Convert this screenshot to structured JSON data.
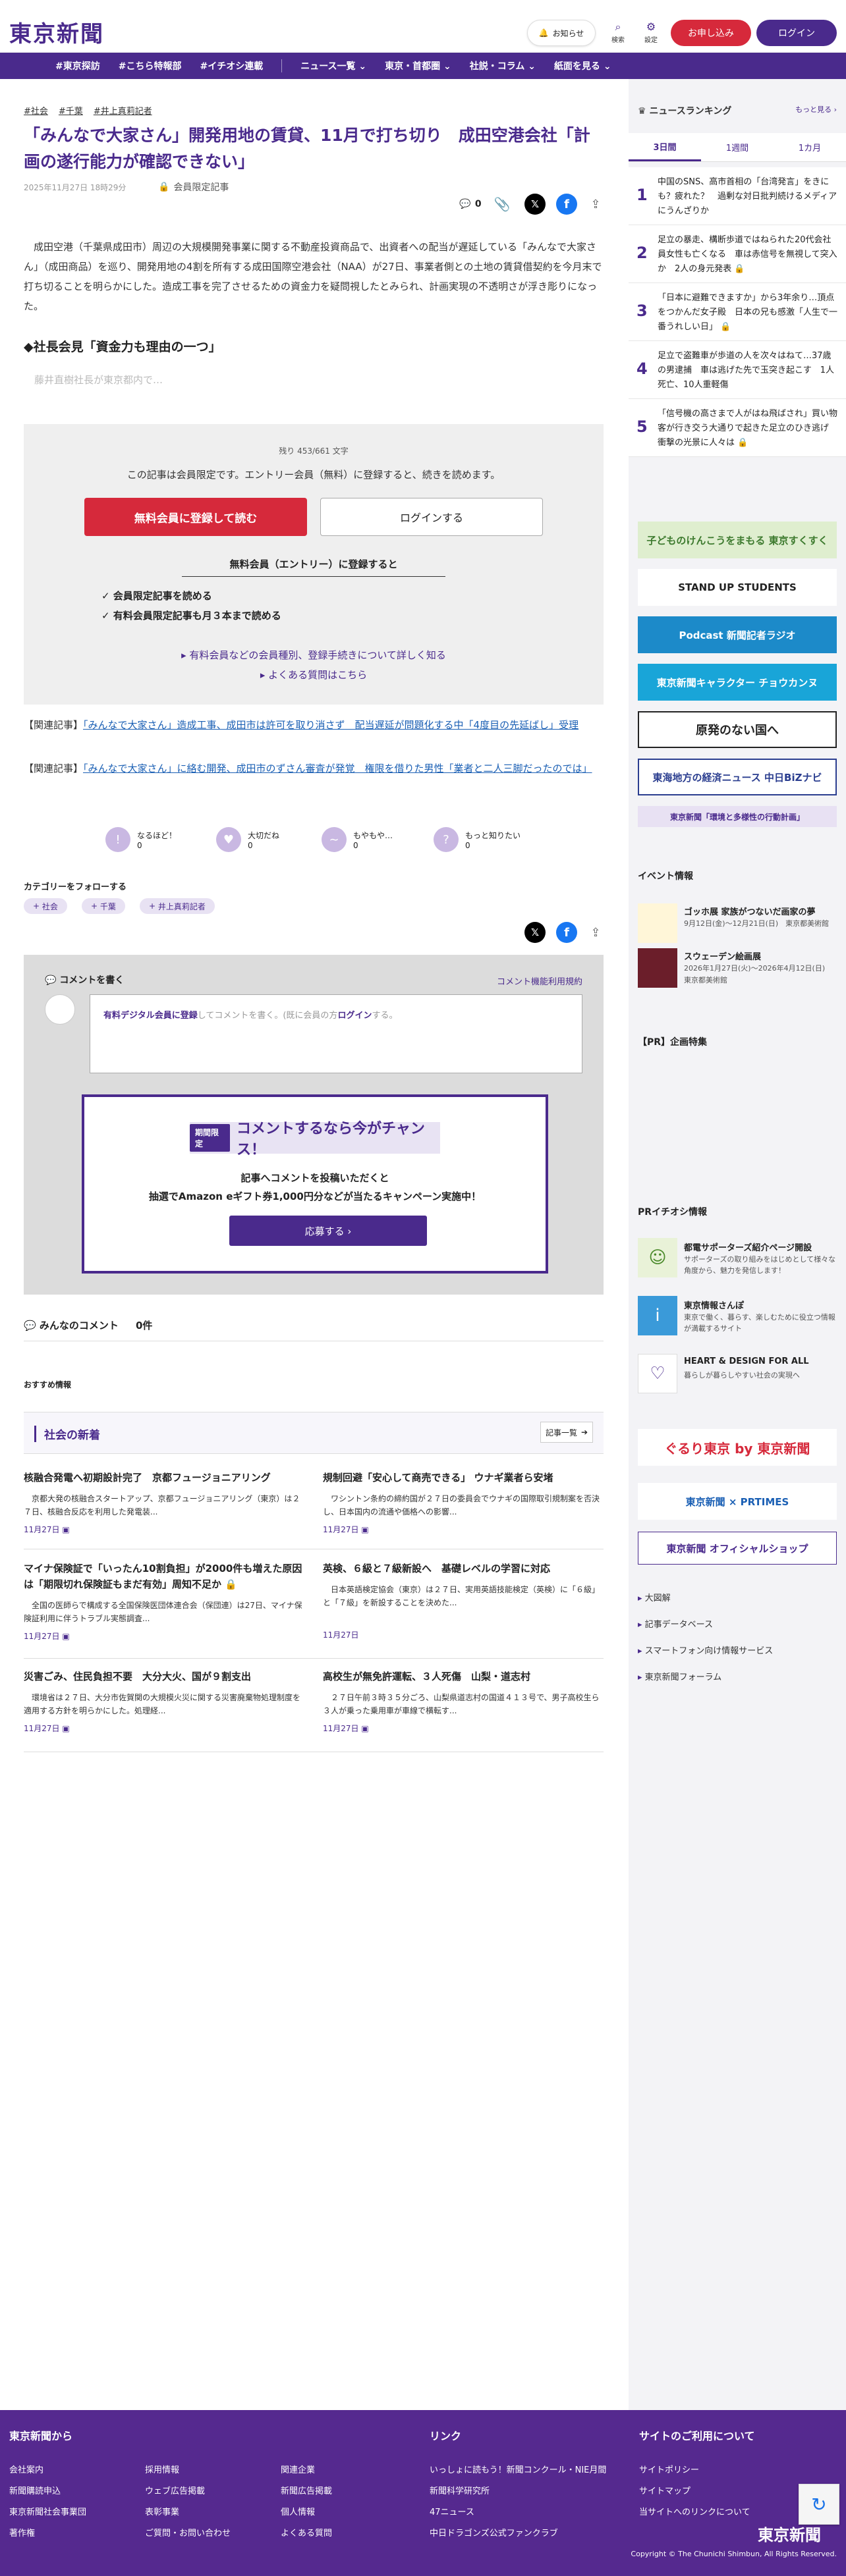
{
  "header": {
    "logo": "東京新聞",
    "notice": "お知らせ",
    "search": "検索",
    "settings": "設定",
    "apply": "お申し込み",
    "login": "ログイン"
  },
  "nav": {
    "items": [
      "#東京探訪",
      "#こちら特報部",
      "#イチオシ連載",
      "ニュース一覧",
      "東京・首都圏",
      "社説・コラム",
      "紙面を見る"
    ]
  },
  "article": {
    "tags": [
      "#社会",
      "#千葉",
      "#井上真莉記者"
    ],
    "title": "「みんなで大家さん」開発用地の賃貸、11月で打ち切り　成田空港会社「計画の遂行能力が確認できない」",
    "date": "2025年11月27日 18時29分",
    "badge": "会員限定記事",
    "comment_count": "0",
    "body": "成田空港（千葉県成田市）周辺の大規模開発事業に関する不動産投資商品で、出資者への配当が遅延している「みんなで大家さん」（成田商品）を巡り、開発用地の4割を所有する成田国際空港会社（NAA）が27日、事業者側との土地の賃貸借契約を今月末で打ち切ることを明らかにした。造成工事を完了させるための資金力を疑問視したとみられ、計画実現の不透明さが浮き彫りになった。",
    "subhead": "◆社長会見「資金力も理由の一つ」",
    "fade": "藤井直樹社長が東京都内で…"
  },
  "paywall": {
    "remaining": "残り 453/661 文字",
    "message": "この記事は会員限定です。エントリー会員（無料）に登録すると、続きを読めます。",
    "free_btn": "無料会員に登録して読む",
    "login_btn": "ログインする",
    "benefit_head": "無料会員（エントリー）に登録すると",
    "benefits": [
      "✓ 会員限定記事を読める",
      "✓ 有料会員限定記事も月３本まで読める"
    ],
    "link1": "▸ 有料会員などの会員種別、登録手続きについて詳しく知る",
    "link2": "▸ よくある質問はこちら"
  },
  "related": [
    {
      "prefix": "【関連記事】",
      "text": "「みんなで大家さん」造成工事、成田市は許可を取り消さず　配当遅延が問題化する中「4度目の先延ばし」受理"
    },
    {
      "prefix": "【関連記事】",
      "text": "「みんなで大家さん」に絡む開発、成田市のずさん審査が発覚　権限を借りた男性「業者と二人三脚だったのでは」"
    }
  ],
  "reactions": [
    {
      "label": "なるほど！",
      "count": "0"
    },
    {
      "label": "大切だね",
      "count": "0"
    },
    {
      "label": "もやもや…",
      "count": "0"
    },
    {
      "label": "もっと知りたい",
      "count": "0"
    }
  ],
  "follow": {
    "title": "カテゴリーをフォローする",
    "tags": [
      "社会",
      "千葉",
      "井上真莉記者"
    ]
  },
  "comment": {
    "write": "コメントを書く",
    "rules": "コメント機能利用規約",
    "input_prefix": "有料デジタル会員に登録",
    "input_mid": "してコメントを書く。(既に会員の方",
    "input_login": "ログイン",
    "input_suffix": "する。",
    "campaign_badge": "期間限定",
    "campaign_title": "コメントするなら今がチャンス！",
    "campaign_line1": "記事へコメントを投稿いただくと",
    "campaign_line2": "抽選でAmazon eギフト券1,000円分などが当たるキャンペーン実施中！",
    "campaign_btn": "応募する ›",
    "all_label": "みんなのコメント",
    "all_count": "0件"
  },
  "recommend": "おすすめ情報",
  "news": {
    "head": "社会の新着",
    "more": "記事一覧",
    "cards": [
      {
        "title": "核融合発電へ初期設計完了　京都フュージョニアリング",
        "excerpt": "京都大発の核融合スタートアップ、京都フュージョニアリング（東京）は２７日、核融合反応を利用した発電装...",
        "date": "11月27日"
      },
      {
        "title": "規制回避「安心して商売できる」 ウナギ業者ら安堵",
        "excerpt": "ワシントン条約の締約国が２７日の委員会でウナギの国際取引規制案を否決し、日本国内の流通や価格への影響...",
        "date": "11月27日"
      },
      {
        "title": "マイナ保険証で「いったん10割負担」が2000件も増えた原因は「期限切れ保険証もまだ有効」周知不足か",
        "excerpt": "全国の医師らで構成する全国保険医団体連合会（保団連）は27日、マイナ保険証利用に伴うトラブル実態調査...",
        "date": "11月27日"
      },
      {
        "title": "英検、６級と７級新設へ　基礎レベルの学習に対応",
        "excerpt": "日本英語検定協会（東京）は２７日、実用英語技能検定（英検）に「６級」と「７級」を新設することを決めた...",
        "date": "11月27日"
      },
      {
        "title": "災害ごみ、住民負担不要　大分大火、国が９割支出",
        "excerpt": "環境省は２７日、大分市佐賀関の大規模火災に関する災害廃棄物処理制度を適用する方針を明らかにした。処理経...",
        "date": "11月27日"
      },
      {
        "title": "高校生が無免許運転、３人死傷　山梨・道志村",
        "excerpt": "２７日午前３時３５分ごろ、山梨県道志村の国道４１３号で、男子高校生ら３人が乗った乗用車が車線で横転す...",
        "date": "11月27日"
      }
    ]
  },
  "rail": {
    "rank_head": "ニュースランキング",
    "rank_more": "もっと見る ›",
    "tabs": [
      "3日間",
      "1週間",
      "1カ月"
    ],
    "ranks": [
      {
        "n": "1",
        "t": "中国のSNS、高市首相の「台湾発言」をきにも？疲れた？　過剰な対日批判続けるメディアにうんざりか"
      },
      {
        "n": "2",
        "t": "足立の暴走、構断歩道ではねられた20代会社員女性も亡くなる　車は赤信号を無視して突入か　2人の身元発表"
      },
      {
        "n": "3",
        "t": "「日本に避難できますか」から3年余り…頂点をつかんだ女子殿　日本の兄も感激「人生で一番うれしい日」"
      },
      {
        "n": "4",
        "t": "足立で盗難車が歩道の人を次々はねて…37歳の男逮捕　車は逃げた先で玉突き起こす　1人死亡、10人重軽傷"
      },
      {
        "n": "5",
        "t": "「信号機の高さまで人がはね飛ばされ」買い物客が行き交う大通りで起きた足立のひき逃げ　衝撃の光景に人々は"
      }
    ],
    "banners": [
      "子どものけんこうをまもる 東京すくすく",
      "STAND UP STUDENTS",
      "Podcast 新聞記者ラジオ",
      "東京新聞キャラクター チョウカンヌ",
      "原発のない国へ",
      "東海地方の経済ニュース 中日BiZナビ",
      "東京新聞「環境と多様性の行動計画」"
    ],
    "event_head": "イベント情報",
    "events": [
      {
        "t": "ゴッホ展 家族がつないだ画家の夢",
        "d": "9月12日(金)〜12月21日(日)　東京都美術館"
      },
      {
        "t": "スウェーデン絵画展",
        "d": "2026年1月27日(火)〜2026年4月12日(日)　東京都美術館"
      }
    ],
    "pr_head": "【PR】企画特集",
    "prichi_head": "PRイチオシ情報",
    "prs": [
      {
        "t": "都電サポーターズ紹介ページ開設",
        "d": "サポーターズの取り組みをはじめとして様々な角度から、魅力を発信します！"
      },
      {
        "t": "東京情報さんぽ",
        "d": "東京で働く、暮らす、楽しむために役立つ情報が満載するサイト"
      },
      {
        "t": "HEART & DESIGN FOR ALL",
        "d": "暮らしが暮らしやすい社会の実現へ"
      }
    ],
    "shop_banners": [
      "ぐるり東京 by 東京新聞",
      "東京新聞 × PRTIMES",
      "東京新聞 オフィシャルショップ"
    ],
    "links": [
      "大図解",
      "記事データベース",
      "スマートフォン向け情報サービス",
      "東京新聞フォーラム"
    ]
  },
  "footer": {
    "col1_head": "東京新聞から",
    "col1": [
      "会社案内",
      "採用情報",
      "関連企業",
      "新聞購読申込",
      "ウェブ広告掲載",
      "新聞広告掲載",
      "東京新聞社会事業団",
      "表彰事業",
      "個人情報",
      "著作権",
      "ご質問・お問い合わせ",
      "よくある質問"
    ],
    "col2_head": "リンク",
    "col2": [
      "いっしょに読もう！新聞コンクール・NIE月間",
      "新聞科学研究所",
      "47ニュース",
      "中日ドラゴンズ公式ファンクラブ"
    ],
    "col3_head": "サイトのご利用について",
    "col3": [
      "サイトポリシー",
      "サイトマップ",
      "当サイトへのリンクについて"
    ],
    "logo": "東京新聞",
    "copyright": "Copyright © The Chunichi Shimbun, All Rights Reserved."
  }
}
